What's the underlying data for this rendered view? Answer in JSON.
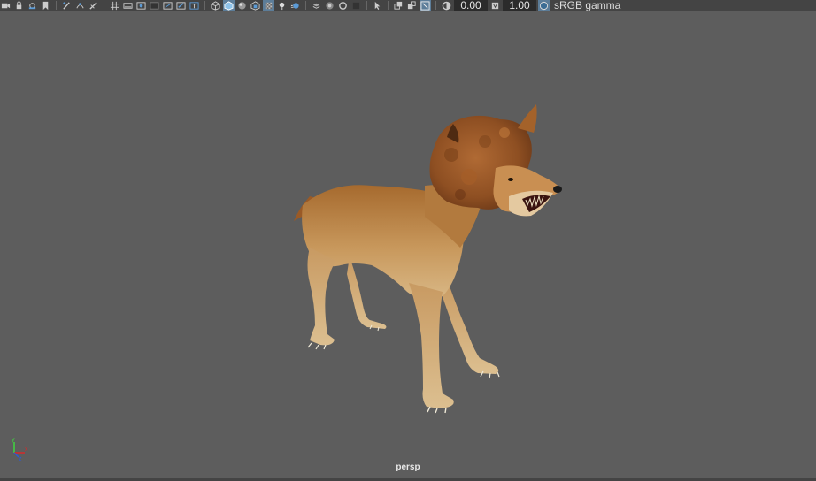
{
  "toolbar": {
    "exposure_value": "0.00",
    "gamma_value": "1.00",
    "color_space_label": "sRGB gamma",
    "icons": [
      "camera-icon",
      "lock-camera-icon",
      "bookmark-icon",
      "grease-pencil-icon",
      "uv-icon",
      "grid-icon",
      "film-gate-icon",
      "resolution-gate-icon",
      "gate-mask-icon",
      "field-chart-icon",
      "safe-action-icon",
      "safe-title-icon",
      "wireframe-icon",
      "smooth-shade-icon",
      "wireframe-on-shaded-icon",
      "textured-icon",
      "use-all-lights-icon",
      "shadows-icon",
      "ambient-occlusion-icon",
      "motion-blur-icon",
      "anti-aliasing-icon",
      "isolate-select-icon",
      "xray-icon",
      "xray-joints-icon",
      "backface-culling-icon",
      "exposure-icon",
      "gamma-icon",
      "color-management-icon"
    ]
  },
  "viewport": {
    "camera_name": "persp",
    "background_color": "#5d5d5d",
    "axis": {
      "x": "x",
      "y": "y",
      "z": "z"
    },
    "model": "textured wolf creature"
  },
  "colors": {
    "toolbar_bg": "#444444",
    "accent": "#5c7d99",
    "field_bg": "#2b2b2b",
    "axis_x": "#d62a2a",
    "axis_y": "#3fd63f",
    "axis_z": "#2a5bd6"
  }
}
